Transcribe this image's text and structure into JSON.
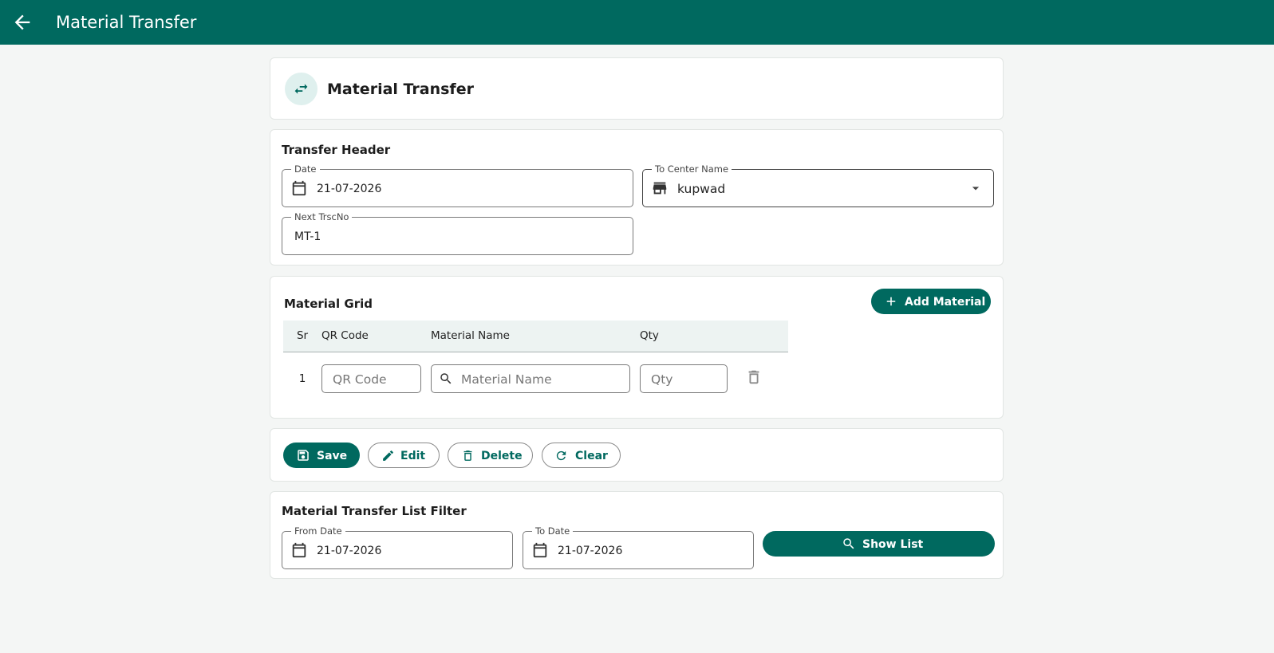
{
  "appbar": {
    "title": "Material Transfer",
    "back_icon": "arrow-left-icon"
  },
  "title_card": {
    "title": "Material Transfer",
    "icon": "swap-horizontal-icon"
  },
  "transfer_header": {
    "title": "Transfer Header",
    "date": {
      "label": "Date",
      "value": "21-07-2026",
      "icon": "calendar-icon"
    },
    "to_center": {
      "label": "To Center Name",
      "value": "kupwad",
      "icon": "store-icon"
    },
    "next_trsc": {
      "label": "Next TrscNo",
      "value": "MT-1"
    }
  },
  "material_grid": {
    "title": "Material Grid",
    "add_button": "Add Material",
    "columns": [
      "Sr",
      "QR Code",
      "Material Name",
      "Qty"
    ],
    "rows": [
      {
        "sr": "1",
        "qr_placeholder": "QR Code",
        "material_placeholder": "Material Name",
        "qty_placeholder": "Qty"
      }
    ]
  },
  "actions": {
    "save": "Save",
    "edit": "Edit",
    "delete": "Delete",
    "clear": "Clear"
  },
  "list_filter": {
    "title": "Material Transfer List Filter",
    "from_date": {
      "label": "From Date",
      "value": "21-07-2026"
    },
    "to_date": {
      "label": "To Date",
      "value": "21-07-2026"
    },
    "show_list": "Show List"
  },
  "colors": {
    "primary": "#00695f",
    "background": "#f4f6f5",
    "grid_header": "#edf3f2",
    "icon_circle": "#dff0ee"
  }
}
